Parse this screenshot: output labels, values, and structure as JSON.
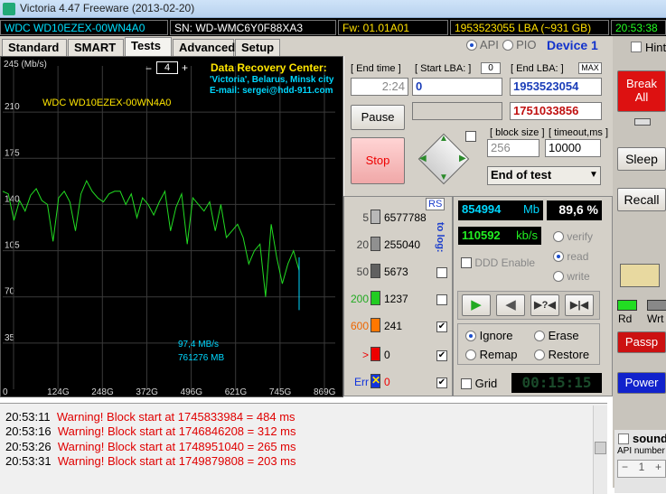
{
  "window": {
    "title": "Victoria 4.47  Freeware (2013-02-20)"
  },
  "info": {
    "model": "WDC WD10EZEX-00WN4A0",
    "serial": "SN: WD-WMC6Y0F88XA3",
    "firmware": "Fw: 01.01A01",
    "lba": "1953523055 LBA (~931 GB)",
    "time": "20:53:38"
  },
  "tabs": [
    "Standard",
    "SMART",
    "Tests",
    "Advanced",
    "Setup"
  ],
  "api": {
    "api_label": "API",
    "pio_label": "PIO",
    "device": "Device 1",
    "hints": "Hints"
  },
  "graph": {
    "max_label": "245 (Mb/s)",
    "yticks": [
      "210",
      "175",
      "140",
      "105",
      "70",
      "35"
    ],
    "xticks": [
      "0",
      "124G",
      "248G",
      "372G",
      "496G",
      "621G",
      "745G",
      "869G"
    ],
    "drive_label": "WDC WD10EZEX-00WN4A0",
    "speed": "97,4 MB/s",
    "position": "761276 MB",
    "zoom": "4",
    "ad1": "Data Recovery Center:",
    "ad2": "'Victoria', Belarus, Minsk city",
    "ad3": "E-mail: sergei@hdd-911.com",
    "line_color": "#22dd22"
  },
  "chart_data": {
    "type": "line",
    "xlabel": "",
    "ylabel": "(Mb/s)",
    "ylim": [
      0,
      245
    ],
    "x_ticks": [
      "0",
      "124G",
      "248G",
      "372G",
      "496G",
      "621G",
      "745G",
      "869G"
    ],
    "series": [
      {
        "values": [
          150,
          148,
          128,
          143,
          135,
          147,
          152,
          143,
          140,
          112,
          145,
          150,
          142,
          120,
          148,
          158,
          150,
          145,
          142,
          148,
          150,
          150,
          140,
          148,
          130,
          145,
          140,
          132,
          142,
          150,
          120,
          138,
          148,
          110,
          145,
          140,
          135,
          142,
          120,
          140,
          115,
          120,
          125,
          115,
          95,
          105,
          110,
          70,
          125,
          100,
          80,
          95,
          105,
          90
        ]
      }
    ]
  },
  "controls": {
    "end_time_label": "[ End time ]",
    "end_time": "2:24",
    "start_lba_label": "[ Start LBA: ]",
    "start_lba_badge": "0",
    "start_lba": "0",
    "end_lba_label": "[ End LBA: ]",
    "end_lba_badge": "MAX",
    "end_lba": "1953523054",
    "current_lba": "1751033856",
    "pause": "Pause",
    "stop": "Stop",
    "block_size_label": "[ block size ]",
    "block_size": "256",
    "timeout_label": "[ timeout,ms ]",
    "timeout": "10000",
    "end_action": "End of test"
  },
  "legend": {
    "rs": "RS",
    "to_log": "to log:",
    "rows": [
      {
        "label": "5",
        "count": "6577788",
        "color": "#b8b8b8"
      },
      {
        "label": "20",
        "count": "255040",
        "color": "#909090"
      },
      {
        "label": "50",
        "count": "5673",
        "color": "#606060"
      },
      {
        "label": "200",
        "count": "1237",
        "color": "#22cc22"
      },
      {
        "label": "600",
        "count": "241",
        "color": "#ff7700"
      },
      {
        "label": ">",
        "count": "0",
        "color": "#ee0000"
      },
      {
        "label": "Err",
        "count": "0",
        "color": "#1133dd"
      }
    ]
  },
  "stats": {
    "mb": "854994",
    "mb_unit": "Mb",
    "percent": "89,6 %",
    "kbs": "110592",
    "kbs_unit": "kb/s",
    "verify": "verify",
    "read": "read",
    "write": "write",
    "ddd": "DDD Enable"
  },
  "actions": {
    "ignore": "Ignore",
    "erase": "Erase",
    "remap": "Remap",
    "restore": "Restore",
    "grid": "Grid",
    "elapsed": "00:15:15"
  },
  "right": {
    "break": "Break All",
    "sleep": "Sleep",
    "recall": "Recall",
    "rd": "Rd",
    "wrt": "Wrt",
    "passp": "Passp",
    "power": "Power",
    "sound": "sound",
    "api_number": "API number",
    "api_value": "1"
  },
  "log": [
    {
      "time": "20:53:11",
      "msg": "Warning! Block start at 1745833984 = 484 ms"
    },
    {
      "time": "20:53:16",
      "msg": "Warning! Block start at 1746846208 = 312 ms"
    },
    {
      "time": "20:53:26",
      "msg": "Warning! Block start at 1748951040 = 265 ms"
    },
    {
      "time": "20:53:31",
      "msg": "Warning! Block start at 1749879808 = 203 ms"
    }
  ]
}
